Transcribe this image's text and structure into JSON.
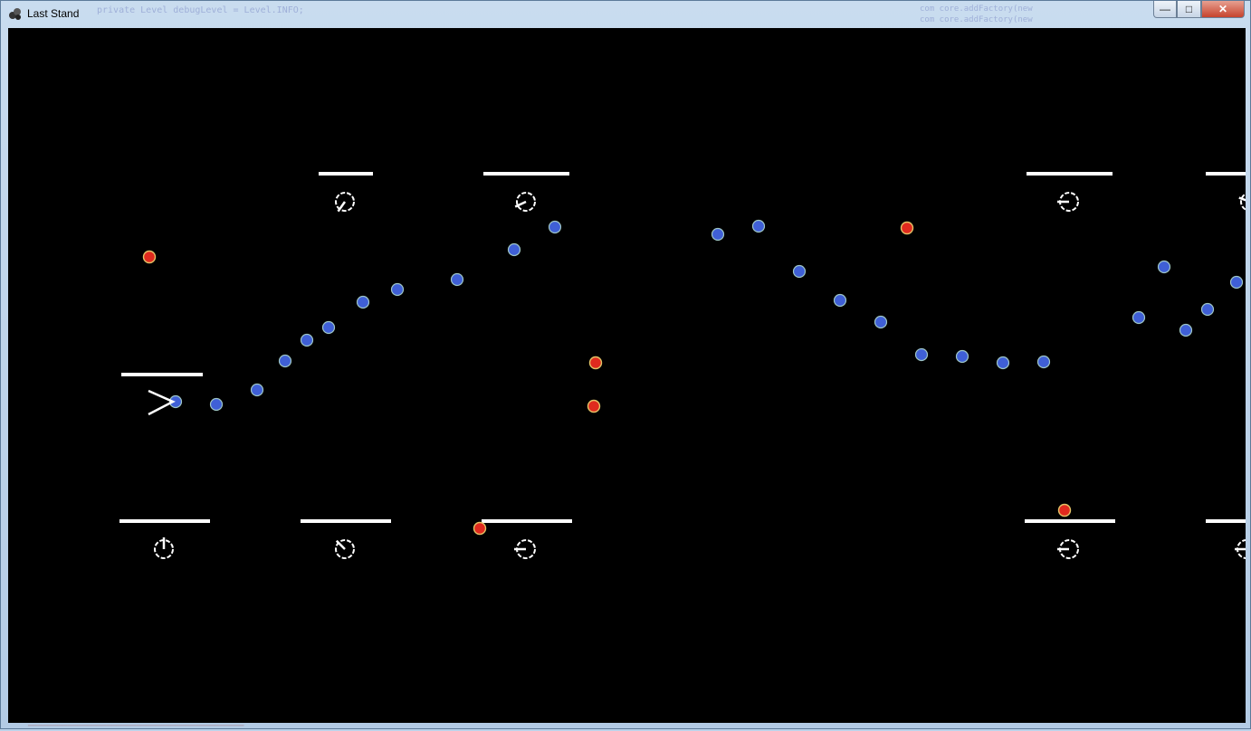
{
  "window": {
    "title": "Last Stand",
    "controls": {
      "minimize": "—",
      "maximize": "□",
      "close": "✕"
    },
    "background_text_left": "private Level debugLevel = Level.INFO;",
    "background_text_right_1": "com          core.addFactory(new",
    "background_text_right_2": "com          core.addFactory(new"
  },
  "game": {
    "background": "#000000",
    "colors": {
      "wall": "#ffffff",
      "ally_fill": "#3f5fd6",
      "ally_ring": "#9ec6c6",
      "enemy_fill": "#e02a1e",
      "enemy_ring": "#e3c266",
      "player": "#ffffff"
    }
  }
}
